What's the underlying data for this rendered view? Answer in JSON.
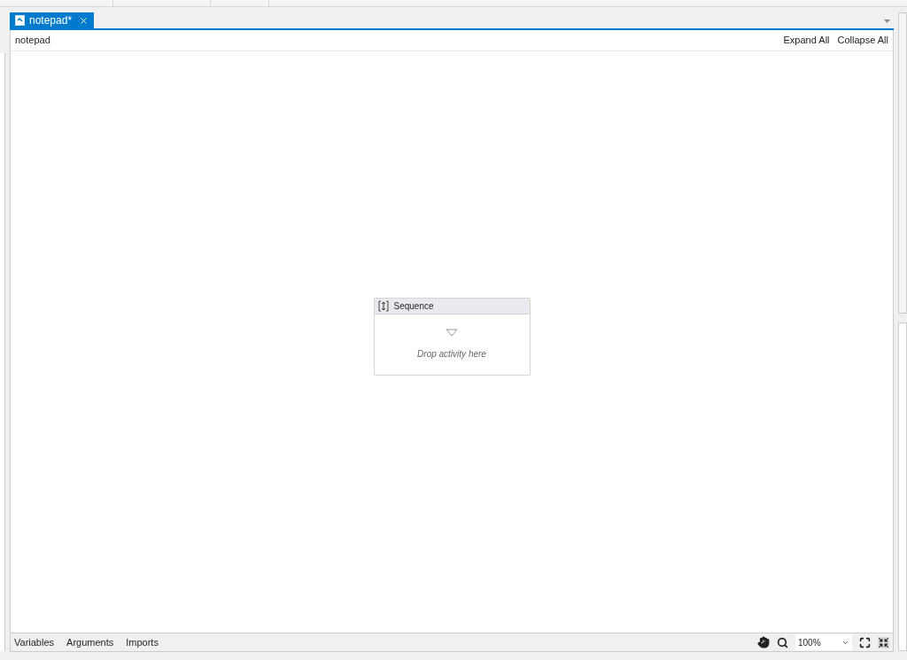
{
  "tab": {
    "title": "notepad*",
    "selected": true
  },
  "breadcrumb": "notepad",
  "header_actions": [
    "Expand All",
    "Collapse All"
  ],
  "activity": {
    "title": "Sequence",
    "hint": "Drop activity here"
  },
  "bottom_tabs": [
    "Variables",
    "Arguments",
    "Imports"
  ],
  "zoom": {
    "value": "100%"
  }
}
